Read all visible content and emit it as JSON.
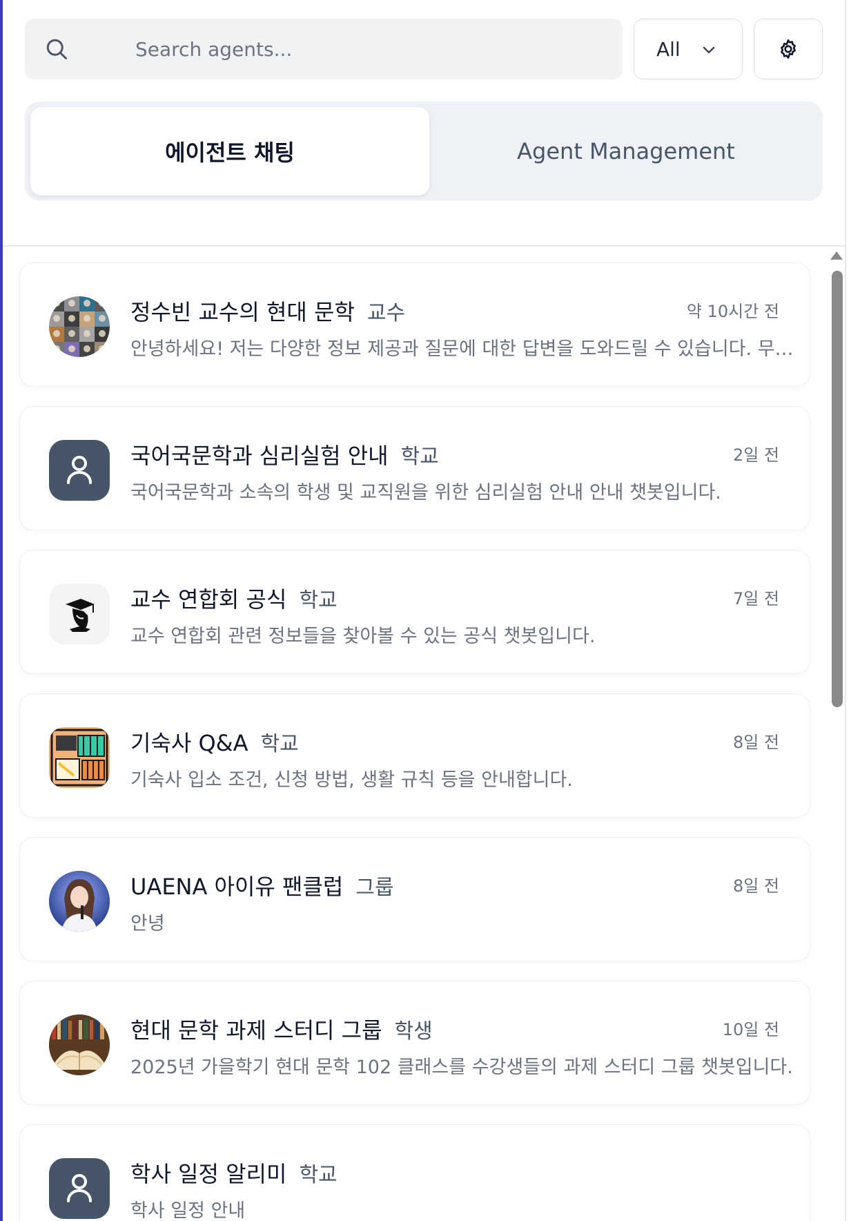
{
  "search": {
    "placeholder": "Search agents..."
  },
  "filter": {
    "selected": "All"
  },
  "tabs": [
    {
      "label": "에이전트 채팅",
      "active": true
    },
    {
      "label": "Agent Management",
      "active": false
    }
  ],
  "agents": [
    {
      "name": "정수빈 교수의 현대 문학",
      "tag": "교수",
      "time": "약 10시간 전",
      "desc": "안녕하세요! 저는 다양한 정보 제공과 질문에 대한 답변을 도와드릴 수 있습니다. 무엇이든 물어보세요!",
      "avatar": "portrait-collage"
    },
    {
      "name": "국어국문학과 심리실험 안내",
      "tag": "학교",
      "time": "2일 전",
      "desc": "국어국문학과 소속의 학생 및 교직원을 위한 심리실험 안내 안내 챗봇입니다.",
      "avatar": "default-user-icon"
    },
    {
      "name": "교수 연합회 공식",
      "tag": "학교",
      "time": "7일 전",
      "desc": "교수 연합회 관련 정보들을 찾아볼 수 있는 공식 챗봇입니다.",
      "avatar": "graduate-icon"
    },
    {
      "name": "기숙사 Q&A",
      "tag": "학교",
      "time": "8일 전",
      "desc": "기숙사 입소 조건, 신청 방법, 생활 규칙 등을 안내합니다.",
      "avatar": "dorm-room-icon"
    },
    {
      "name": "UAENA 아이유 팬클럽",
      "tag": "그룹",
      "time": "8일 전",
      "desc": "안녕",
      "avatar": "singer-photo"
    },
    {
      "name": "현대 문학 과제 스터디 그룹",
      "tag": "학생",
      "time": "10일 전",
      "desc": "2025년 가을학기 현대 문학 102 클래스를 수강생들의 과제 스터디 그룹 챗봇입니다.",
      "avatar": "books-photo"
    },
    {
      "name": "학사 일정 알리미",
      "tag": "학교",
      "time": "",
      "desc": "학사 일정 안내",
      "avatar": "default-user-icon"
    }
  ],
  "colors": {
    "accent_indigo": "#3b3bb8",
    "avatar_dark": "#475569",
    "tab_bg": "#eef2f7",
    "search_bg": "#f1f2f4"
  },
  "scrollbar": {
    "position": 0.0,
    "visible_fraction": 0.45
  }
}
